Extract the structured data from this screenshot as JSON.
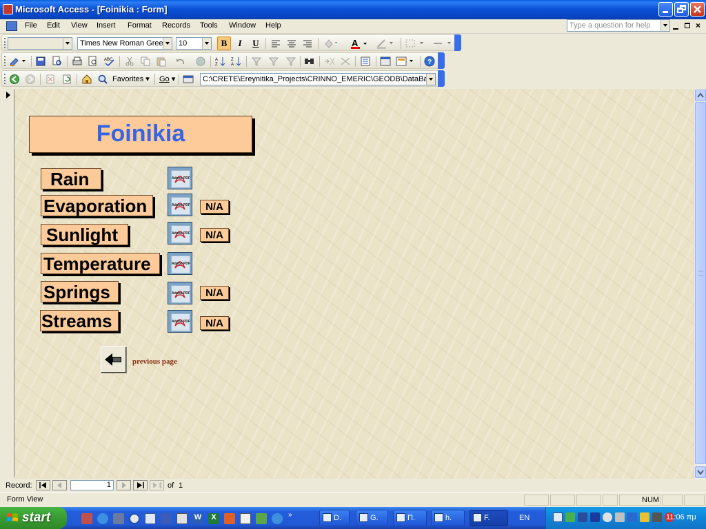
{
  "window": {
    "title": "Microsoft Access - [Foinikia : Form]"
  },
  "menu": {
    "items": [
      {
        "label": "File"
      },
      {
        "label": "Edit"
      },
      {
        "label": "View"
      },
      {
        "label": "Insert"
      },
      {
        "label": "Format"
      },
      {
        "label": "Records"
      },
      {
        "label": "Tools"
      },
      {
        "label": "Window"
      },
      {
        "label": "Help"
      }
    ],
    "ask_placeholder": "Type a question for help"
  },
  "formatting_toolbar": {
    "object_value": "",
    "font_value": "Times New Roman Greek",
    "size_value": "10"
  },
  "web_toolbar": {
    "favorites_label": "Favorites",
    "go_label": "Go",
    "address_value": "C:\\CRETE\\Ereynitika_Projects\\CRINNO_EMERIC\\GEODB\\DataBase"
  },
  "form": {
    "title": "Foinikia",
    "buttons": [
      {
        "label": "Rain",
        "na": ""
      },
      {
        "label": "Evaporation",
        "na": "N/A"
      },
      {
        "label": "Sunlight",
        "na": "N/A"
      },
      {
        "label": "Temperature",
        "na": ""
      },
      {
        "label": "Springs",
        "na": "N/A"
      },
      {
        "label": "Streams",
        "na": "N/A"
      }
    ],
    "pdf_icon_text": "Adobe PDF",
    "previous_page_label": "previous page"
  },
  "record_nav": {
    "label": "Record:",
    "current": "1",
    "of_label": "of",
    "total": "1"
  },
  "status": {
    "view": "Form View",
    "num": "NUM"
  },
  "taskbar": {
    "start_label": "start",
    "tasks": [
      {
        "label": "D."
      },
      {
        "label": "G."
      },
      {
        "label": "Π."
      },
      {
        "label": "h."
      },
      {
        "label": "F.",
        "active": true
      }
    ],
    "language": "EN",
    "clock": "11:06 πμ"
  },
  "colors": {
    "form_button_fill": "#fccb99",
    "form_title_text": "#3565e4",
    "previous_label_text": "#8a2c10",
    "xp_blue": "#0b52d6"
  }
}
